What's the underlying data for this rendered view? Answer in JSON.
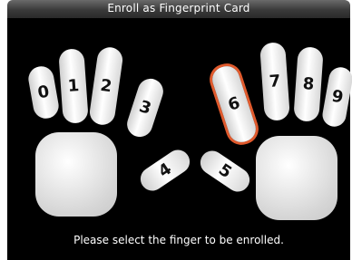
{
  "window": {
    "title": "Enroll as Fingerprint Card"
  },
  "fingers": [
    {
      "label": "0",
      "selected": false
    },
    {
      "label": "1",
      "selected": false
    },
    {
      "label": "2",
      "selected": false
    },
    {
      "label": "3",
      "selected": false
    },
    {
      "label": "4",
      "selected": false
    },
    {
      "label": "5",
      "selected": false
    },
    {
      "label": "6",
      "selected": true
    },
    {
      "label": "7",
      "selected": false
    },
    {
      "label": "8",
      "selected": false
    },
    {
      "label": "9",
      "selected": false
    }
  ],
  "status": {
    "text": "Please select the finger to be enrolled."
  },
  "colors": {
    "accent": "#e05a2d",
    "background": "#000000",
    "titlebar": "#3a3a3a"
  }
}
